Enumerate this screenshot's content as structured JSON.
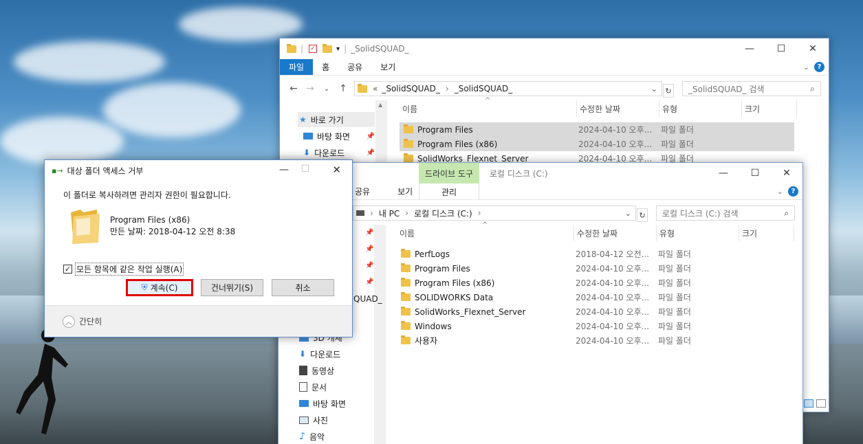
{
  "win_back": {
    "title": "_SolidSQUAD_",
    "ribbon_tabs": [
      "파일",
      "홈",
      "공유",
      "보기"
    ],
    "breadcrumb_prefix": "«",
    "breadcrumb": [
      "_SolidSQUAD_",
      "_SolidSQUAD_"
    ],
    "search_placeholder": "_SolidSQUAD_ 검색",
    "columns": [
      "이름",
      "수정한 날짜",
      "유형",
      "크기"
    ],
    "rows": [
      {
        "name": "Program Files",
        "date": "2024-04-10 오후...",
        "type": "파일 폴더",
        "selected": true
      },
      {
        "name": "Program Files (x86)",
        "date": "2024-04-10 오후...",
        "type": "파일 폴더",
        "selected": true
      },
      {
        "name": "SolidWorks_Flexnet_Server",
        "date": "2024-04-10 오후...",
        "type": "파일 폴더",
        "selected": false
      }
    ],
    "quick_access": "바로 가기",
    "side_items": [
      "바탕 화면",
      "다운로드"
    ]
  },
  "win_front": {
    "title": "로컬 디스크 (C:)",
    "ribbon_tabs": [
      "공유",
      "보기"
    ],
    "context_tab": "드라이브 도구",
    "context_sub": "관리",
    "breadcrumb": [
      "내 PC",
      "로컬 디스크 (C:)"
    ],
    "search_placeholder": "로컬 디스크 (C:) 검색",
    "columns": [
      "이름",
      "수정한 날짜",
      "유형",
      "크기"
    ],
    "rows": [
      {
        "name": "PerfLogs",
        "date": "2018-04-12 오전...",
        "type": "파일 폴더"
      },
      {
        "name": "Program Files",
        "date": "2024-04-10 오후...",
        "type": "파일 폴더"
      },
      {
        "name": "Program Files (x86)",
        "date": "2024-04-10 오후...",
        "type": "파일 폴더"
      },
      {
        "name": "SOLIDWORKS Data",
        "date": "2024-04-10 오후...",
        "type": "파일 폴더"
      },
      {
        "name": "SolidWorks_Flexnet_Server",
        "date": "2024-04-10 오후...",
        "type": "파일 폴더"
      },
      {
        "name": "Windows",
        "date": "2024-04-10 오후...",
        "type": "파일 폴더"
      },
      {
        "name": "사용자",
        "date": "2024-04-10 오후...",
        "type": "파일 폴더"
      }
    ],
    "side_items_partial": [
      "QUAD_",
      "3D 개체"
    ],
    "side_items": [
      "다운로드",
      "동영상",
      "문서",
      "바탕 화면",
      "사진",
      "음악"
    ]
  },
  "dialog": {
    "title": "대상 폴더 액세스 거부",
    "message": "이 폴더로 복사하려면 관리자 권한이 필요합니다.",
    "item_name": "Program Files (x86)",
    "item_date": "만든 날짜: 2018-04-12 오전 8:38",
    "checkbox_label": "모든 항목에 같은 작업 실행(A)",
    "checkbox_checked": true,
    "btn_continue": "계속(C)",
    "btn_skip": "건너뛰기(S)",
    "btn_cancel": "취소",
    "less_details": "간단히"
  },
  "colors": {
    "accent": "#1979ca",
    "context_tab": "#c6e8b0",
    "highlight_border": "#e00000"
  }
}
